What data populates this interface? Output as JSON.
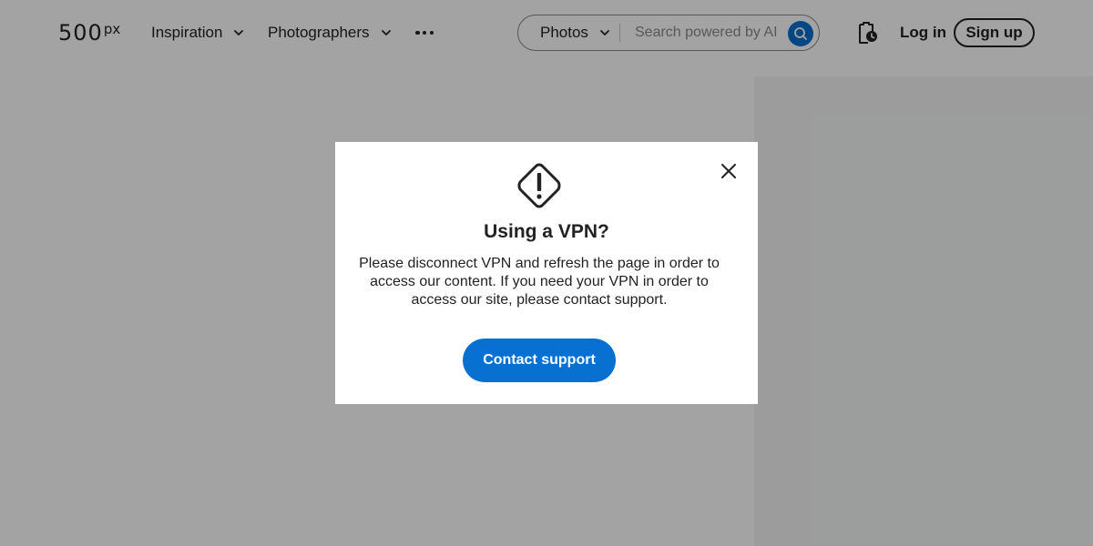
{
  "header": {
    "logo": {
      "main": "500",
      "sup": "px"
    },
    "nav": {
      "inspiration": "Inspiration",
      "photographers": "Photographers"
    },
    "search": {
      "scope": "Photos",
      "placeholder": "Search powered by AI"
    },
    "login_label": "Log in",
    "signup_label": "Sign up"
  },
  "modal": {
    "icon": "warning-diamond-icon",
    "title": "Using a VPN?",
    "body": "Please disconnect VPN and refresh the page in order to access our content. If you need your VPN in order to access our site, please contact support.",
    "button_label": "Contact support"
  },
  "colors": {
    "accent": "#0870d1",
    "text": "#222222",
    "overlay": "rgba(0,0,0,0.36)"
  }
}
